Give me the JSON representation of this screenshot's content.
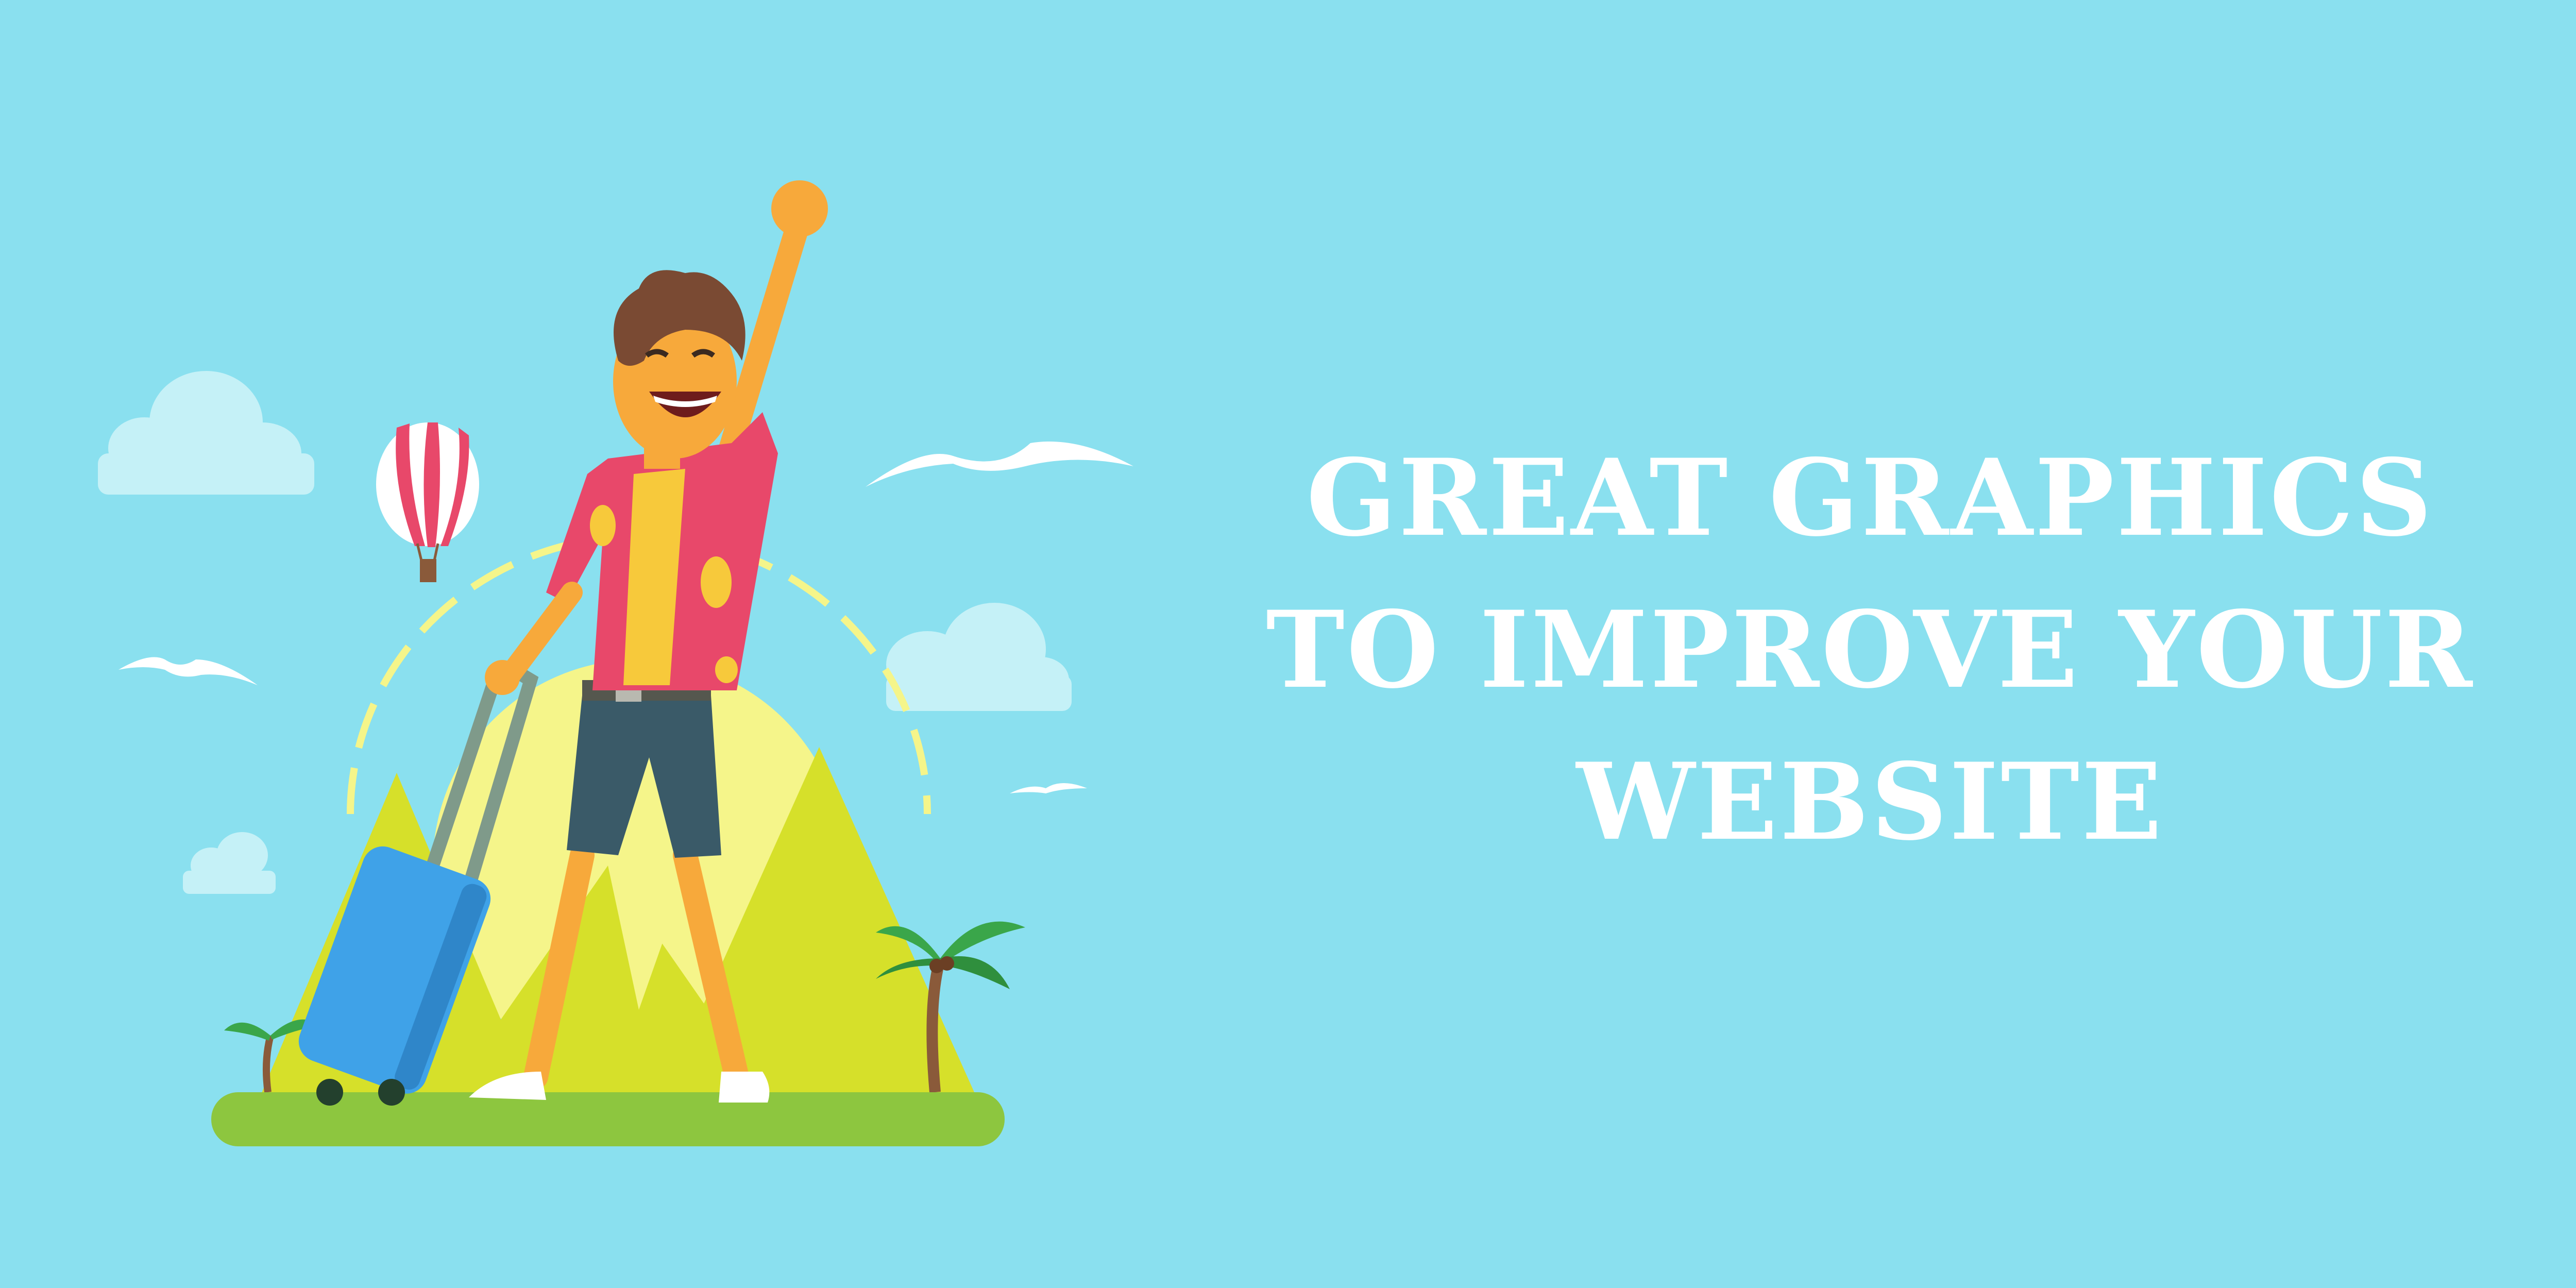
{
  "headline": {
    "lines": [
      "GREAT GRAPHICS",
      "TO IMPROVE YOUR",
      "WEBSITE"
    ]
  },
  "colors": {
    "background": "#8ae0ef",
    "headline_text": "#ffffff",
    "grass": "#8dc63f",
    "mountain": "#d6e02a",
    "sun": "#f5f58a",
    "suitcase": "#3fa2e8",
    "shirt": "#e8486a",
    "skin": "#f7a93b",
    "hair": "#7a4a33"
  },
  "illustration": {
    "icons": [
      "cloud-icon",
      "hot-air-balloon-icon",
      "bird-icon",
      "mountain-icon",
      "sun-icon",
      "palm-tree-icon",
      "suitcase-icon",
      "traveler-figure"
    ]
  }
}
